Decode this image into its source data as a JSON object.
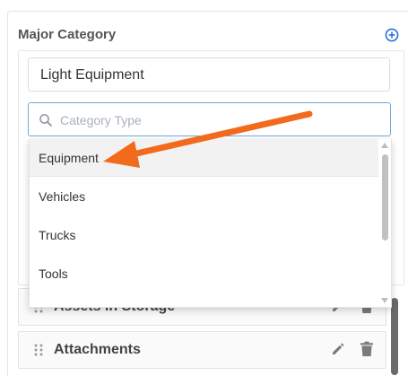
{
  "section": {
    "title": "Major Category"
  },
  "major_category_field": {
    "value": "Light Equipment"
  },
  "search": {
    "placeholder": "Category Type",
    "value": ""
  },
  "dropdown": {
    "options": [
      {
        "label": "Equipment",
        "highlighted": true
      },
      {
        "label": "Vehicles"
      },
      {
        "label": "Trucks"
      },
      {
        "label": "Tools"
      }
    ]
  },
  "rows": [
    {
      "label": "Assets in Storage"
    },
    {
      "label": "Attachments"
    }
  ],
  "icons": {
    "add": "plus-circle-icon",
    "search": "search-icon",
    "drag": "drag-handle-icon",
    "edit": "pencil-icon",
    "delete": "trash-icon"
  },
  "colors": {
    "accent": "#2b6fd6",
    "focus_border": "#6fa9dc",
    "annotation_arrow": "#f26a1b",
    "highlight_bg": "#f2f2f2"
  }
}
